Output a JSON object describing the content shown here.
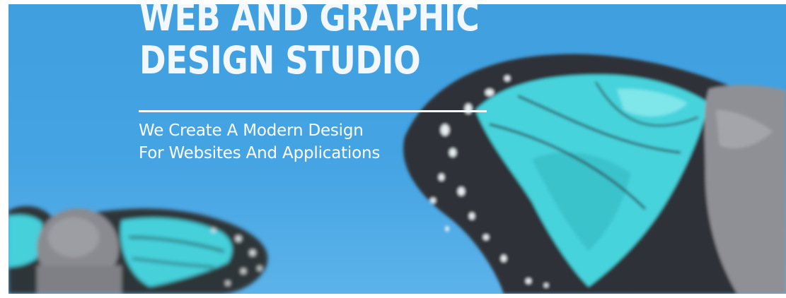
{
  "hero": {
    "headline": {
      "line1": "WEB AND GRAPHIC",
      "line2": "DESIGN STUDIO"
    },
    "subheadline": {
      "line1": "We Create A Modern Design",
      "line2": "For Websites And Applications"
    }
  },
  "colors": {
    "sky": "#45a4e3",
    "wing_dark": "#2e3338",
    "wing_cyan": "#45d6de",
    "body_gray": "#8e8f94",
    "text": "#ffffff"
  }
}
